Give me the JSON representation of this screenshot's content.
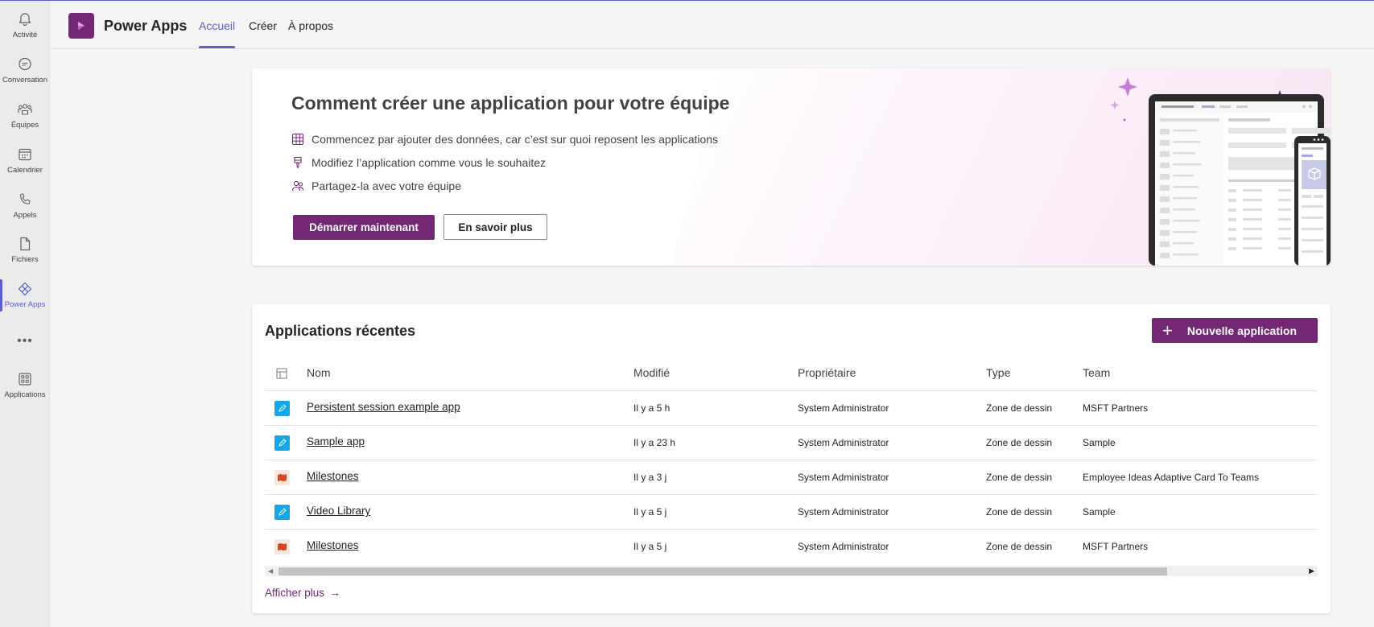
{
  "colors": {
    "accent": "#5b5fc7",
    "brand": "#742774",
    "canvas_icon": "#11a7e8"
  },
  "rail": {
    "items": [
      {
        "label": "Activité",
        "icon": "bell-icon"
      },
      {
        "label": "Conversation",
        "icon": "chat-icon"
      },
      {
        "label": "Équipes",
        "icon": "teams-icon"
      },
      {
        "label": "Calendrier",
        "icon": "calendar-icon"
      },
      {
        "label": "Appels",
        "icon": "phone-icon"
      },
      {
        "label": "Fichiers",
        "icon": "file-icon"
      },
      {
        "label": "Power Apps",
        "icon": "power-apps-icon"
      },
      {
        "label": "Applications",
        "icon": "apps-grid-icon"
      }
    ],
    "more": "•••"
  },
  "header": {
    "app_name": "Power Apps",
    "tabs": [
      "Accueil",
      "Créer",
      "À propos"
    ],
    "active_tab": "Accueil"
  },
  "hero": {
    "title": "Comment créer une application pour votre équipe",
    "lines": [
      "Commencez par ajouter des données, car c’est sur quoi reposent les applications",
      "Modifiez l’application comme vous le souhaitez",
      "Partagez-la avec votre équipe"
    ],
    "primary_button": "Démarrer maintenant",
    "secondary_button": "En savoir plus"
  },
  "recent": {
    "title": "Applications récentes",
    "new_button": "Nouvelle application",
    "columns": [
      "Nom",
      "Modifié",
      "Propriétaire",
      "Type",
      "Team"
    ],
    "rows": [
      {
        "icon": "canvas-app-icon",
        "name": "Persistent session example app",
        "modified": "Il y a 5 h",
        "owner": "System Administrator",
        "type": "Zone de dessin",
        "team": "MSFT Partners"
      },
      {
        "icon": "canvas-app-icon",
        "name": "Sample app",
        "modified": "Il y a 23 h",
        "owner": "System Administrator",
        "type": "Zone de dessin",
        "team": "Sample"
      },
      {
        "icon": "map-app-icon",
        "name": "Milestones",
        "modified": "Il y a 3 j",
        "owner": "System Administrator",
        "type": "Zone de dessin",
        "team": "Employee Ideas Adaptive Card To Teams"
      },
      {
        "icon": "canvas-app-icon",
        "name": "Video Library",
        "modified": "Il y a 5 j",
        "owner": "System Administrator",
        "type": "Zone de dessin",
        "team": "Sample"
      },
      {
        "icon": "map-app-icon",
        "name": "Milestones",
        "modified": "Il y a 5 j",
        "owner": "System Administrator",
        "type": "Zone de dessin",
        "team": "MSFT Partners"
      }
    ],
    "show_more": "Afficher plus"
  }
}
